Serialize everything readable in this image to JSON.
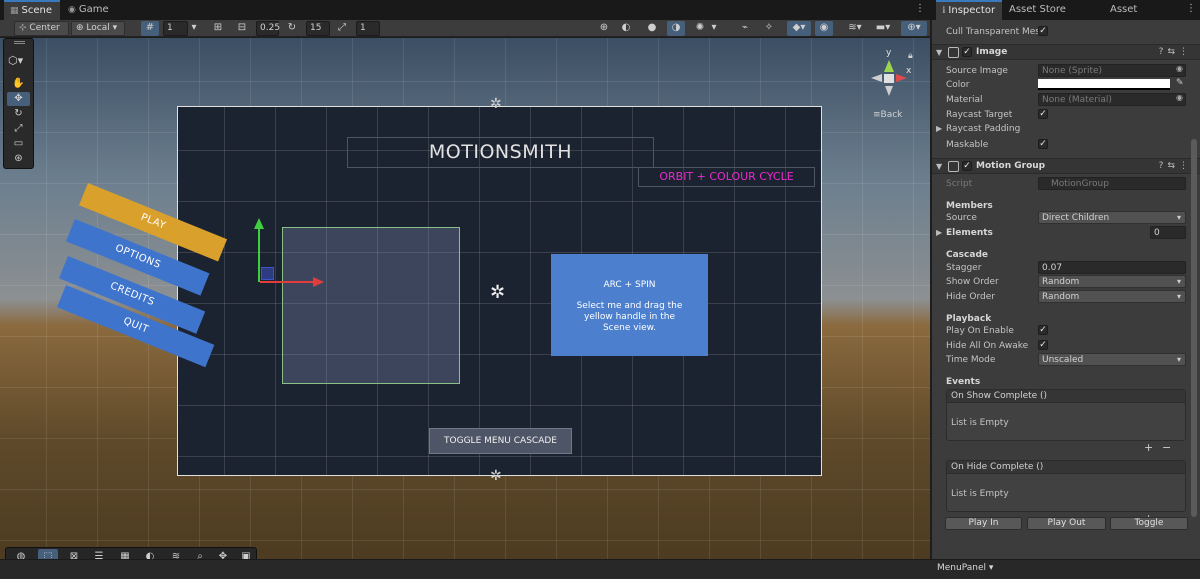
{
  "tabs": {
    "scene": "Scene",
    "game": "Game",
    "inspector": "Inspector",
    "asset_store_uploader": "Asset Store Uploader",
    "asset_store": "Asset Store"
  },
  "scene_toolbar": {
    "pivot_mode": "Center",
    "pivot_rotation": "Local",
    "grid_size": "1",
    "snap_increment": "0.25",
    "rotation_snap": "15",
    "scale_snap": "1"
  },
  "gizmo": {
    "y_label": "y",
    "x_label": "x",
    "back_label": "Back"
  },
  "canvas": {
    "title": "MOTIONSMITH",
    "orbit_label": "ORBIT + COLOUR CYCLE",
    "arc_title": "ARC + SPIN",
    "arc_body": "Select me and drag the yellow handle in the Scene view.",
    "toggle_button": "TOGGLE MENU CASCADE",
    "menu_items": [
      "PLAY",
      "OPTIONS",
      "CREDITS",
      "QUIT"
    ],
    "colors": {
      "orbit_text": "#ea2bd0",
      "arc_panel": "#4c7fce",
      "play_button": "#d9a12b",
      "menu_button": "#3f74cc"
    }
  },
  "inspector": {
    "cull_transparent_mesh": "Cull Transparent Mesh",
    "image_component": {
      "title": "Image",
      "source_image_label": "Source Image",
      "source_image_value": "None (Sprite)",
      "color_label": "Color",
      "material_label": "Material",
      "material_value": "None (Material)",
      "raycast_target_label": "Raycast Target",
      "raycast_padding_label": "Raycast Padding",
      "maskable_label": "Maskable"
    },
    "motion_group": {
      "title": "Motion Group",
      "script_label": "Script",
      "script_value": "MotionGroup",
      "members_header": "Members",
      "source_label": "Source",
      "source_value": "Direct Children",
      "elements_label": "Elements",
      "elements_value": "0",
      "cascade_header": "Cascade",
      "stagger_label": "Stagger",
      "stagger_value": "0.07",
      "show_order_label": "Show Order",
      "show_order_value": "Random",
      "hide_order_label": "Hide Order",
      "hide_order_value": "Random",
      "playback_header": "Playback",
      "play_on_enable_label": "Play On Enable",
      "hide_all_on_awake_label": "Hide All On Awake",
      "time_mode_label": "Time Mode",
      "time_mode_value": "Unscaled",
      "events_header": "Events",
      "on_show_complete": "On Show Complete ()",
      "on_hide_complete": "On Hide Complete ()",
      "list_empty": "List is Empty",
      "play_in_button": "Play In",
      "play_out_button": "Play Out",
      "toggle_button": "Toggle"
    }
  },
  "statusbar": {
    "object_name": "MenuPanel"
  }
}
